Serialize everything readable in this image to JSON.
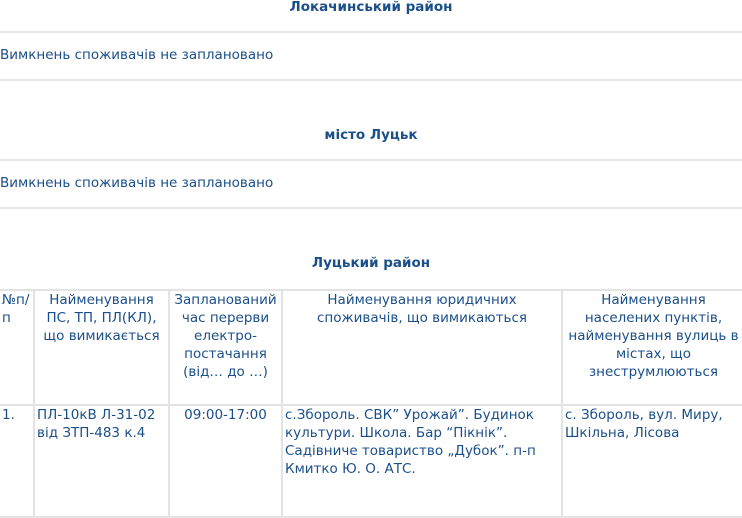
{
  "sections": [
    {
      "title": "Локачинський район",
      "note": "Вимкнень споживачів не заплановано"
    },
    {
      "title": "місто Луцьк",
      "note": "Вимкнень споживачів не заплановано"
    },
    {
      "title": "Луцький район"
    }
  ],
  "table": {
    "headers": [
      "№п/п",
      "Найменування ПС, ТП, ПЛ(КЛ), що вимикається",
      "Запланований час перерви електро-постачання (від… до …)",
      "Найменування юридичних споживачів, що вимикаються",
      "Найменування населених пунктів, найменування вулиць в містах, що знеструмлюються"
    ],
    "rows": [
      {
        "num": "1.",
        "object": "ПЛ-10кВ Л-31-02 від ЗТП-483 к.4",
        "time": "09:00-17:00",
        "consumers": "с.Збороль. СВК” Урожай”. Будинок культури. Школа. Бар “Пікнік”.  Садівниче товариство „Дубок”. п-п Кмитко Ю. О. АТС.",
        "locations": "с. Збороль, вул. Миру, Шкільна, Лісова"
      }
    ]
  }
}
